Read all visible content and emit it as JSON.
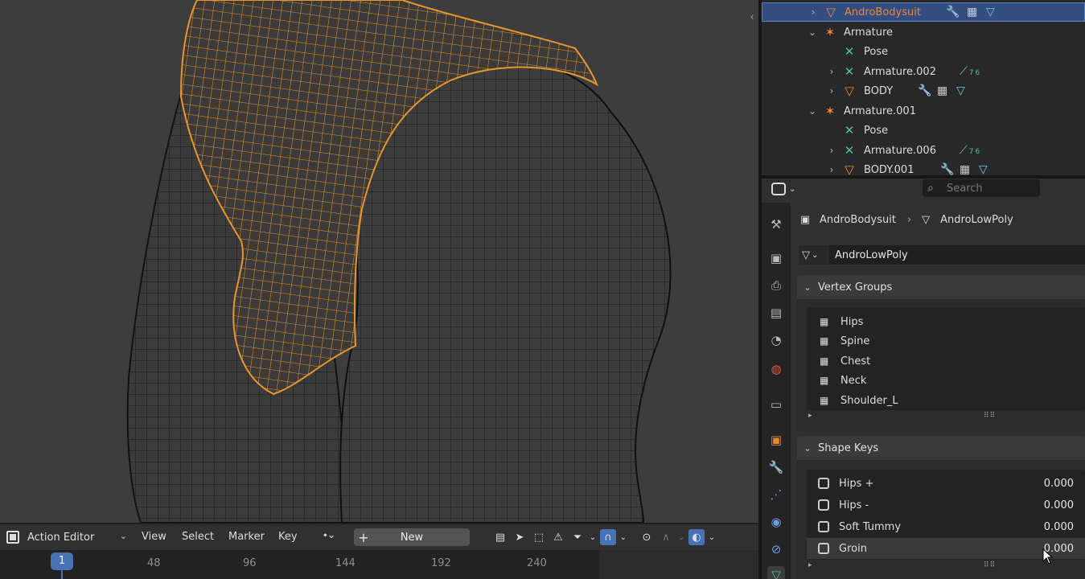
{
  "outliner": {
    "rows": [
      {
        "name": "AndroBodysuit",
        "arrow": "›",
        "selected": true
      },
      {
        "name": "Armature",
        "arrow": "⌄"
      },
      {
        "name": "Pose"
      },
      {
        "name": "Armature.002",
        "arrow": "›",
        "badge": "76"
      },
      {
        "name": "BODY",
        "arrow": "›"
      },
      {
        "name": "Armature.001",
        "arrow": "⌄"
      },
      {
        "name": "Pose"
      },
      {
        "name": "Armature.006",
        "arrow": "›",
        "badge": "76"
      },
      {
        "name": "BODY.001",
        "arrow": "›"
      }
    ]
  },
  "properties": {
    "search_placeholder": "Search",
    "breadcrumb": {
      "object": "AndroBodysuit",
      "mesh": "AndroLowPoly"
    },
    "mesh_data_name": "AndroLowPoly",
    "vertex_groups": {
      "title": "Vertex Groups",
      "items": [
        "Hips",
        "Spine",
        "Chest",
        "Neck",
        "Shoulder_L"
      ]
    },
    "shape_keys": {
      "title": "Shape Keys",
      "items": [
        {
          "name": "Hips +",
          "value": "0.000"
        },
        {
          "name": "Hips -",
          "value": "0.000"
        },
        {
          "name": "Soft Tummy",
          "value": "0.000"
        },
        {
          "name": "Groin",
          "value": "0.000"
        }
      ]
    }
  },
  "action_editor": {
    "mode": "Action Editor",
    "menus": [
      "View",
      "Select",
      "Marker",
      "Key"
    ],
    "new_label": "New",
    "current_frame": "1",
    "ticks": [
      "48",
      "96",
      "144",
      "192",
      "240"
    ]
  },
  "colors": {
    "selection": "#334d80",
    "accent": "#4772b3",
    "mesh_selected": "#e8952f",
    "mesh_unselected": "#141414"
  }
}
